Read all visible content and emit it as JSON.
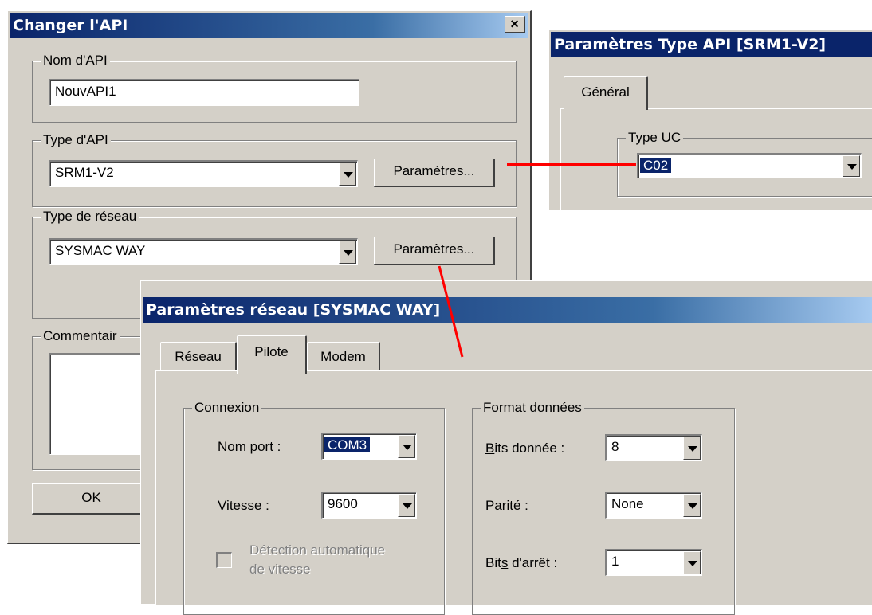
{
  "main_dialog": {
    "title": "Changer l'API",
    "close_icon": "×",
    "plc_name": {
      "legend": "Nom d'API",
      "value": "NouvAPI1"
    },
    "plc_type": {
      "legend": "Type d'API",
      "value": "SRM1-V2",
      "button": "Paramètres..."
    },
    "network_type": {
      "legend": "Type de réseau",
      "value": "SYSMAC WAY",
      "button": "Paramètres..."
    },
    "comment": {
      "legend": "Commentair"
    },
    "ok_button": "OK"
  },
  "plc_type_dialog": {
    "title": "Paramètres Type API [SRM1-V2]",
    "tab": "Général",
    "cpu_type": {
      "legend": "Type UC",
      "value": "C02"
    }
  },
  "network_dialog": {
    "title": "Paramètres réseau [SYSMAC WAY]",
    "tabs": [
      "Réseau",
      "Pilote",
      "Modem"
    ],
    "active_tab": "Pilote",
    "connection": {
      "legend": "Connexion",
      "port_label": "Nom port :",
      "port_value": "COM3",
      "speed_label": "Vitesse :",
      "speed_value": "9600",
      "auto_detect_line1": "Détection automatique",
      "auto_detect_line2": "de vitesse"
    },
    "data_format": {
      "legend": "Format données",
      "data_bits_label": "Bits donnée :",
      "data_bits_value": "8",
      "parity_label": "Parité :",
      "parity_value": "None",
      "stop_bits_label": "Bits d'arrêt :",
      "stop_bits_value": "1"
    }
  },
  "colors": {
    "title_bar": "#0a246a",
    "connector": "#ff0000",
    "dialog_face": "#d4d0c8"
  },
  "icons": [
    "close-icon",
    "dropdown-arrow-icon",
    "checkbox-icon"
  ]
}
